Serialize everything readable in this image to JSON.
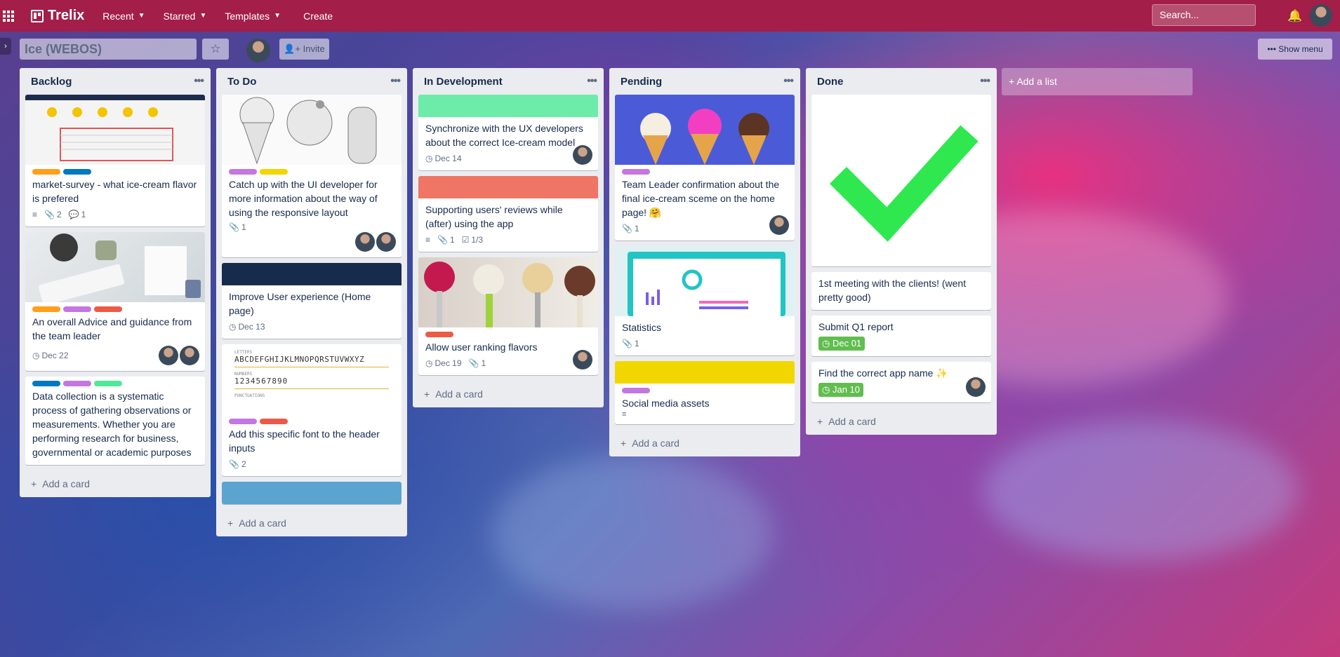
{
  "topbar": {
    "logo": "Trelix",
    "nav": [
      "Recent",
      "Starred",
      "Templates",
      "Create"
    ],
    "search_placeholder": "Search..."
  },
  "board": {
    "title": "Ice (WEBOS)",
    "invite_label": "Invite",
    "show_menu_label": "Show menu",
    "add_list_label": "Add a list",
    "add_card_label": "Add a card"
  },
  "lists": [
    {
      "name": "Backlog",
      "cards": [
        {
          "title": "market-survey - what ice-cream flavor is prefered",
          "attachments": "2",
          "comments": "1"
        },
        {
          "title": "An overall Advice and guidance from the team leader",
          "due": "Dec 22"
        },
        {
          "title": "Data collection is a systematic process of gathering observations or measurements. Whether you are performing research for business, governmental or academic purposes"
        }
      ]
    },
    {
      "name": "To Do",
      "cards": [
        {
          "title": "Catch up with the UI developer for more information about the way of using the responsive layout",
          "attachments": "1"
        },
        {
          "title": "Improve User experience (Home page)",
          "due": "Dec 13"
        },
        {
          "title": "Add this specific font to the header inputs",
          "attachments": "2",
          "font_sample": {
            "letters_caption": "LETTERS",
            "letters": "ABCDEFGHIJKLMNOPQRSTUVWXYZ",
            "numbers_caption": "NUMBERS",
            "numbers": "1234567890",
            "punct_caption": "PUNCTUATIONS"
          }
        }
      ]
    },
    {
      "name": "In Development",
      "cards": [
        {
          "title": "Synchronize with the UX developers about the correct Ice-cream model",
          "due": "Dec 14"
        },
        {
          "title": "Supporting users' reviews while (after) using the app",
          "attachments": "1",
          "checklist": "1/3"
        },
        {
          "title": "Allow user ranking flavors",
          "due": "Dec 19",
          "attachments": "1"
        }
      ]
    },
    {
      "name": "Pending",
      "cards": [
        {
          "title": "Team Leader confirmation about the final ice-cream sceme on the home page! 🤗",
          "attachments": "1"
        },
        {
          "title": "Statistics",
          "attachments": "1"
        },
        {
          "title": "Social media assets"
        }
      ]
    },
    {
      "name": "Done",
      "cards": [
        {
          "title": "1st meeting with the clients! (went pretty good)"
        },
        {
          "title": "Submit Q1 report",
          "due": "Dec 01"
        },
        {
          "title": "Find the correct app name ✨",
          "due": "Jan 10"
        }
      ]
    }
  ],
  "colors": {
    "orange": "#ff9f1a",
    "blue": "#0079bf",
    "red": "#eb5a46",
    "purple": "#c377e0",
    "green_light": "#51e898",
    "yellow": "#f2d600",
    "navy": "#172b4d",
    "salmon": "#ef7564",
    "sky": "#5ba4cf",
    "mint": "#6deca9",
    "due_done": "#61bd4f"
  }
}
